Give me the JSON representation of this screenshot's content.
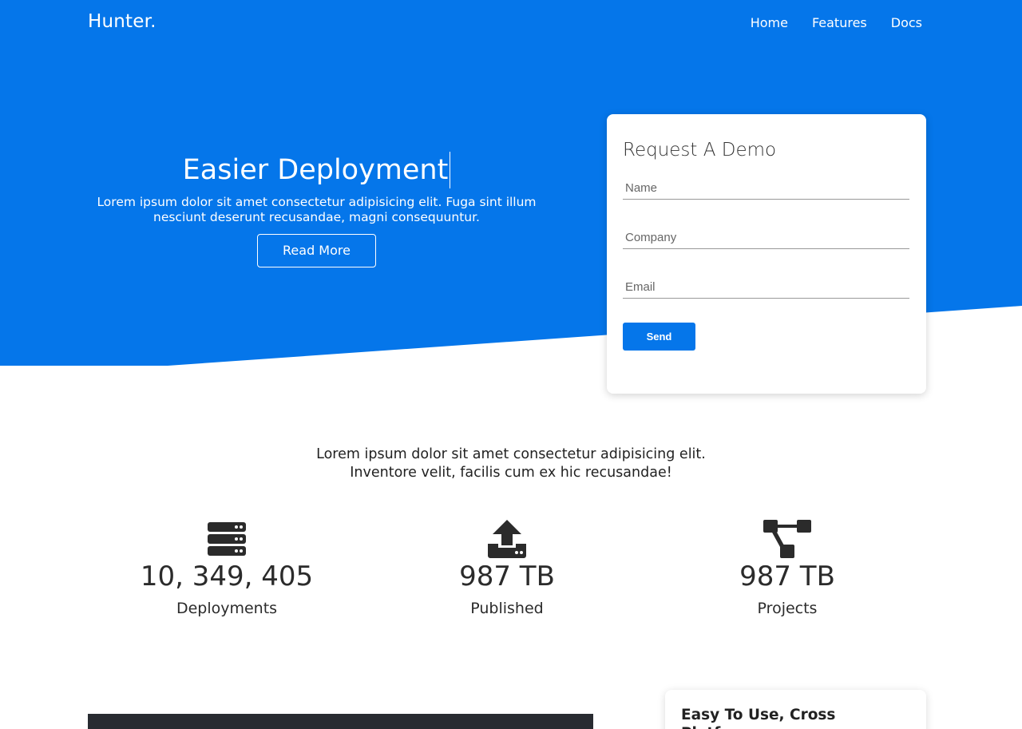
{
  "colors": {
    "brand": "#0576ea",
    "text_dark": "#2b2b2b",
    "panel_dark": "#282b31"
  },
  "nav": {
    "logo": "Hunter.",
    "links": [
      "Home",
      "Features",
      "Docs"
    ]
  },
  "hero": {
    "title": "Easier Deployment",
    "description": "Lorem ipsum dolor sit amet consectetur adipisicing elit. Fuga sint illum nesciunt deserunt recusandae, magni consequuntur.",
    "button": "Read More"
  },
  "demo_form": {
    "title": "Request A Demo",
    "fields": [
      {
        "placeholder": "Name",
        "value": ""
      },
      {
        "placeholder": "Company",
        "value": ""
      },
      {
        "placeholder": "Email",
        "value": ""
      }
    ],
    "submit": "Send"
  },
  "intro": "Lorem ipsum dolor sit amet consectetur adipisicing elit. Inventore velit, facilis cum ex hic recusandae!",
  "stats": [
    {
      "icon": "server-icon",
      "value": "10, 349, 405",
      "label": "Deployments"
    },
    {
      "icon": "upload-icon",
      "value": "987 TB",
      "label": "Published"
    },
    {
      "icon": "project-diagram-icon",
      "value": "987 TB",
      "label": "Projects"
    }
  ],
  "feature_card": {
    "title": "Easy To Use, Cross Platform"
  }
}
